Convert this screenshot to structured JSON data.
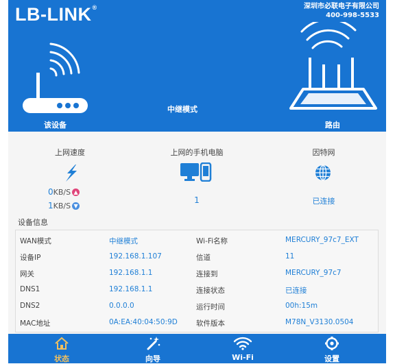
{
  "brand": {
    "logo": "LB-LINK",
    "registered": "®",
    "company": "深圳市必联电子有限公司",
    "phone": "400-998-5533"
  },
  "banner": {
    "device_label": "该设备",
    "mode_label": "中继模式",
    "router_label": "路由"
  },
  "stats": {
    "speed": {
      "title": "上网速度",
      "upload_value": "0",
      "upload_unit": "KB/S",
      "download_value": "1",
      "download_unit": "KB/S"
    },
    "clients": {
      "title": "上网的手机电脑",
      "value": "1"
    },
    "internet": {
      "title": "因特网",
      "value": "已连接"
    }
  },
  "device_info": {
    "title": "设备信息",
    "rows": [
      {
        "k1": "WAN模式",
        "v1": "中继模式",
        "k2": "Wi-Fi名称",
        "v2": "MERCURY_97c7_EXT"
      },
      {
        "k1": "设备IP",
        "v1": "192.168.1.107",
        "k2": "信道",
        "v2": "11"
      },
      {
        "k1": "网关",
        "v1": "192.168.1.1",
        "k2": "连接到",
        "v2": "MERCURY_97c7"
      },
      {
        "k1": "DNS1",
        "v1": "192.168.1.1",
        "k2": "连接状态",
        "v2": "已连接"
      },
      {
        "k1": "DNS2",
        "v1": "0.0.0.0",
        "k2": "运行时间",
        "v2": "00h:15m"
      },
      {
        "k1": "MAC地址",
        "v1": "0A:EA:40:04:50:9D",
        "k2": "软件版本",
        "v2": "M78N_V3130.0504"
      }
    ]
  },
  "nav": {
    "status": "状态",
    "wizard": "向导",
    "wifi": "Wi-Fi",
    "settings": "设置"
  },
  "colors": {
    "banner": "#1874d2",
    "accent": "#1f7fd6",
    "active_nav": "#f0c060",
    "upload_arrow": "#e0457a",
    "download_arrow": "#4a8fe0"
  }
}
